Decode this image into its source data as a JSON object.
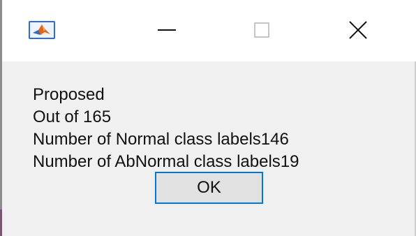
{
  "window": {
    "title_icon": "matlab-icon",
    "controls": {
      "minimize_icon": "minimize-icon",
      "maximize_icon": "maximize-icon",
      "close_icon": "close-icon"
    },
    "accent_color": "#0078d7"
  },
  "dialog": {
    "lines": [
      "Proposed",
      "Out of 165",
      "Number of Normal class labels146",
      "Number of AbNormal class labels19"
    ],
    "ok_label": "OK"
  }
}
